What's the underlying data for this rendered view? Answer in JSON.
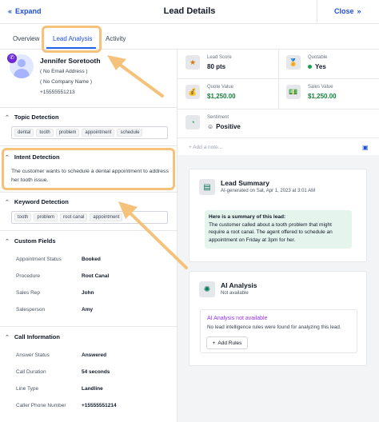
{
  "header": {
    "expand_label": "Expand",
    "title": "Lead Details",
    "close_label": "Close"
  },
  "tabs": [
    {
      "label": "Overview"
    },
    {
      "label": "Lead Analysis"
    },
    {
      "label": "Activity"
    }
  ],
  "contact": {
    "name": "Jennifer Soretooth",
    "email": "( No Email Address )",
    "company": "( No Company Name )",
    "phone": "+15555551213"
  },
  "topic_detection": {
    "title": "Topic Detection",
    "tags": [
      "dental",
      "tooth",
      "problem",
      "appointment",
      "schedule"
    ]
  },
  "intent_detection": {
    "title": "Intent Detection",
    "text": "The customer wants to schedule a dental appointment to address her tooth issue."
  },
  "keyword_detection": {
    "title": "Keyword Detection",
    "tags": [
      "tooth",
      "problem",
      "root canal",
      "appointment"
    ]
  },
  "custom_fields": {
    "title": "Custom Fields",
    "rows": [
      {
        "label": "Appointment Status",
        "value": "Booked"
      },
      {
        "label": "Procedure",
        "value": "Root Canal"
      },
      {
        "label": "Sales Rep",
        "value": "John"
      },
      {
        "label": "Salesperson",
        "value": "Amy"
      }
    ]
  },
  "call_information": {
    "title": "Call Information",
    "rows": [
      {
        "label": "Answer Status",
        "value": "Answered"
      },
      {
        "label": "Call Duration",
        "value": "54 seconds"
      },
      {
        "label": "Line Type",
        "value": "Landline"
      },
      {
        "label": "Caller Phone Number",
        "value": "+15555551214"
      }
    ]
  },
  "metrics": {
    "lead_score": {
      "label": "Lead Score",
      "value": "80 pts",
      "icon": "star-icon"
    },
    "quotable": {
      "label": "Quotable",
      "value": "Yes",
      "icon": "award-icon"
    },
    "quote_value": {
      "label": "Quote Value",
      "value": "$1,250.00",
      "icon": "money-bag-icon"
    },
    "sales_value": {
      "label": "Sales Value",
      "value": "$1,250.00",
      "icon": "cash-register-icon"
    },
    "sentiment": {
      "label": "Sentiment",
      "value": "Positive",
      "icon": "sentiment-gauge-icon"
    }
  },
  "add_note_placeholder": "+ Add a note...",
  "lead_summary": {
    "title": "Lead Summary",
    "subtitle": "AI-generated on Sat, Apr 1, 2023 at 3:01 AM",
    "heading": "Here is a summary of this lead:",
    "body": "The customer called about a tooth problem that might require a root canal. The agent offered to schedule an appointment on Friday at 3pm for her."
  },
  "ai_analysis": {
    "title": "AI Analysis",
    "subtitle": "Not available",
    "na_title": "AI Analysis not available",
    "na_text": "No lead intelligence rules were found for analyzing this lead.",
    "add_rules_label": "Add Rules"
  },
  "colors": {
    "accent_blue": "#1d4ed8",
    "highlight": "#f4c27a",
    "value_green": "#15803d",
    "summary_bg": "#e6f4ee",
    "na_purple": "#9333ea"
  }
}
